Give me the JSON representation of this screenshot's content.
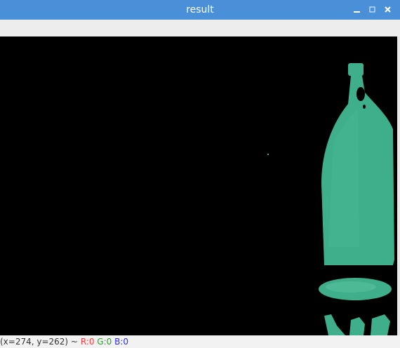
{
  "window": {
    "title": "result",
    "buttons": {
      "minimize": "minimize-icon",
      "maximize": "maximize-icon",
      "close": "close-icon"
    }
  },
  "status": {
    "coords": "(x=274, y=262) ~",
    "r": "R:0",
    "g": "G:0",
    "b": "B:0"
  },
  "colors": {
    "titlebar": "#4a90d9",
    "bottle": "#3fae8a",
    "r_label": "#ff3b3b",
    "g_label": "#26a526",
    "b_label": "#2a2aff"
  }
}
